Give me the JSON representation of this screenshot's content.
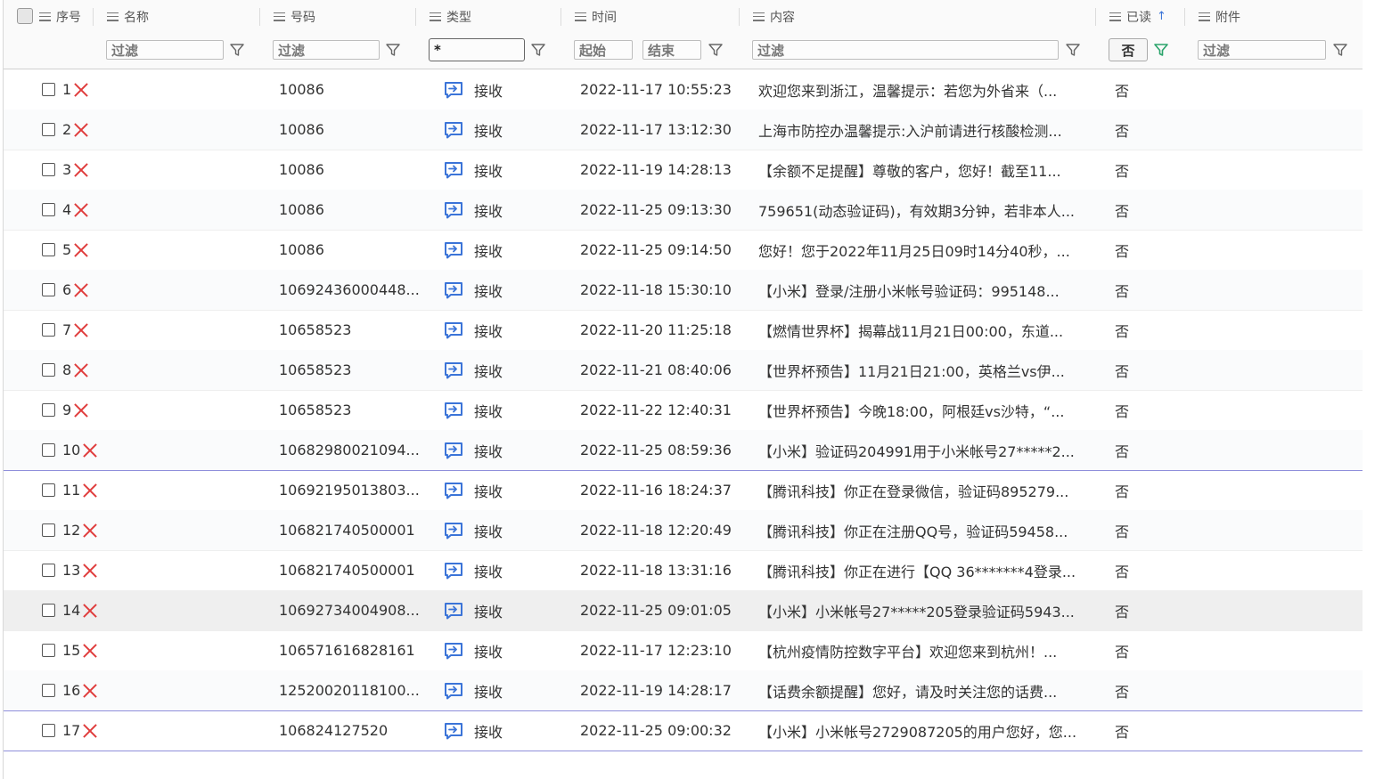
{
  "columns": {
    "seq": "序号",
    "name": "名称",
    "number": "号码",
    "type": "类型",
    "time": "时间",
    "content": "内容",
    "read": "已读",
    "attachment": "附件"
  },
  "filters": {
    "name": "过滤",
    "number": "过滤",
    "type": "*",
    "time_start": "起始",
    "time_end": "结束",
    "content": "过滤",
    "read": "否",
    "attachment": "过滤"
  },
  "icons": {
    "column_menu": "list-icon",
    "filter": "funnel-icon",
    "sort": "arrow-up-icon",
    "delete": "close-icon",
    "message_type": "message-in-icon"
  },
  "colors": {
    "delete": "#e03c3c",
    "message_icon": "#3b74d8",
    "sort_arrow": "#3b74d8",
    "active_filter": "#2aa36b",
    "selection_line": "#8f8fdb"
  },
  "rows": [
    {
      "seq": "1",
      "number": "10086",
      "type": "接收",
      "time": "2022-11-17 10:55:23",
      "content": "欢迎您来到浙江，温馨提示：若您为外省来（...",
      "read": "否"
    },
    {
      "seq": "2",
      "number": "10086",
      "type": "接收",
      "time": "2022-11-17 13:12:30",
      "content": "上海市防控办温馨提示:入沪前请进行核酸检测...",
      "read": "否"
    },
    {
      "seq": "3",
      "number": "10086",
      "type": "接收",
      "time": "2022-11-19 14:28:13",
      "content": "【余额不足提醒】尊敬的客户，您好！截至11...",
      "read": "否"
    },
    {
      "seq": "4",
      "number": "10086",
      "type": "接收",
      "time": "2022-11-25 09:13:30",
      "content": "759651(动态验证码)，有效期3分钟，若非本人...",
      "read": "否"
    },
    {
      "seq": "5",
      "number": "10086",
      "type": "接收",
      "time": "2022-11-25 09:14:50",
      "content": "您好！您于2022年11月25日09时14分40秒，...",
      "read": "否"
    },
    {
      "seq": "6",
      "number": "10692436000448...",
      "type": "接收",
      "time": "2022-11-18 15:30:10",
      "content": "【小米】登录/注册小米帐号验证码：995148...",
      "read": "否"
    },
    {
      "seq": "7",
      "number": "10658523",
      "type": "接收",
      "time": "2022-11-20 11:25:18",
      "content": "【燃情世界杯】揭幕战11月21日00:00，东道...",
      "read": "否"
    },
    {
      "seq": "8",
      "number": "10658523",
      "type": "接收",
      "time": "2022-11-21 08:40:06",
      "content": "【世界杯预告】11月21日21:00，英格兰vs伊...",
      "read": "否"
    },
    {
      "seq": "9",
      "number": "10658523",
      "type": "接收",
      "time": "2022-11-22 12:40:31",
      "content": "【世界杯预告】今晚18:00，阿根廷vs沙特，“...",
      "read": "否"
    },
    {
      "seq": "10",
      "number": "10682980021094...",
      "type": "接收",
      "time": "2022-11-25 08:59:36",
      "content": "【小米】验证码204991用于小米帐号27*****2...",
      "read": "否"
    },
    {
      "seq": "11",
      "number": "10692195013803...",
      "type": "接收",
      "time": "2022-11-16 18:24:37",
      "content": "【腾讯科技】你正在登录微信，验证码895279...",
      "read": "否"
    },
    {
      "seq": "12",
      "number": "106821740500001",
      "type": "接收",
      "time": "2022-11-18 12:20:49",
      "content": "【腾讯科技】你正在注册QQ号，验证码59458...",
      "read": "否"
    },
    {
      "seq": "13",
      "number": "106821740500001",
      "type": "接收",
      "time": "2022-11-18 13:31:16",
      "content": "【腾讯科技】你正在进行【QQ 36*******4登录...",
      "read": "否"
    },
    {
      "seq": "14",
      "number": "10692734004908...",
      "type": "接收",
      "time": "2022-11-25 09:01:05",
      "content": "【小米】小米帐号27*****205登录验证码5943...",
      "read": "否"
    },
    {
      "seq": "15",
      "number": "106571616828161",
      "type": "接收",
      "time": "2022-11-17 12:23:10",
      "content": "【杭州疫情防控数字平台】欢迎您来到杭州！...",
      "read": "否"
    },
    {
      "seq": "16",
      "number": "12520020118100...",
      "type": "接收",
      "time": "2022-11-19 14:28:17",
      "content": "【话费余额提醒】您好，请及时关注您的话费...",
      "read": "否"
    },
    {
      "seq": "17",
      "number": "106824127520",
      "type": "接收",
      "time": "2022-11-25 09:00:32",
      "content": "【小米】小米帐号2729087205的用户您好，您...",
      "read": "否"
    }
  ]
}
